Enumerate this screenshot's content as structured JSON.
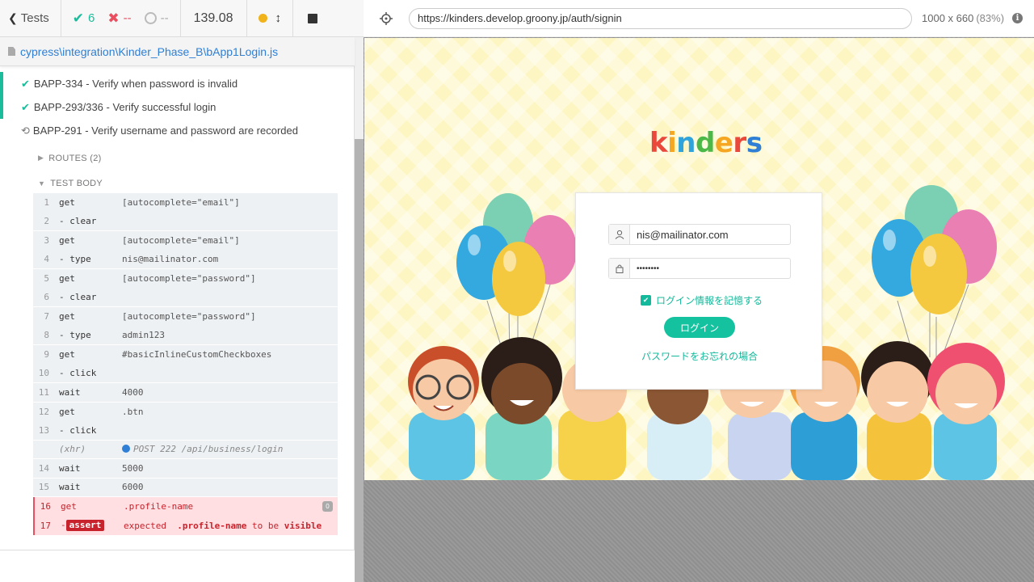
{
  "topbar": {
    "tests_label": "Tests",
    "passed": "6",
    "failed": "--",
    "pending": "--",
    "duration": "139.08"
  },
  "spec": {
    "path": "cypress\\integration\\Kinder_Phase_B\\bApp1Login.js"
  },
  "tests": [
    {
      "title": "BAPP-334 - Verify when password is invalid",
      "state": "passed"
    },
    {
      "title": "BAPP-293/336 - Verify successful login",
      "state": "passed"
    },
    {
      "title": "BAPP-291 - Verify username and password are recorded",
      "state": "running"
    }
  ],
  "sections": {
    "routes": "ROUTES (2)",
    "test_body": "TEST BODY"
  },
  "commands": [
    {
      "num": "1",
      "name": "get",
      "msg": "[autocomplete=\"email\"]"
    },
    {
      "num": "2",
      "name": "- clear",
      "msg": ""
    },
    {
      "num": "3",
      "name": "get",
      "msg": "[autocomplete=\"email\"]"
    },
    {
      "num": "4",
      "name": "- type",
      "msg": "nis@mailinator.com"
    },
    {
      "num": "5",
      "name": "get",
      "msg": "[autocomplete=\"password\"]"
    },
    {
      "num": "6",
      "name": "- clear",
      "msg": ""
    },
    {
      "num": "7",
      "name": "get",
      "msg": "[autocomplete=\"password\"]"
    },
    {
      "num": "8",
      "name": "- type",
      "msg": "admin123"
    },
    {
      "num": "9",
      "name": "get",
      "msg": "#basicInlineCustomCheckboxes"
    },
    {
      "num": "10",
      "name": "- click",
      "msg": ""
    },
    {
      "num": "11",
      "name": "wait",
      "msg": "4000"
    },
    {
      "num": "12",
      "name": "get",
      "msg": ".btn"
    },
    {
      "num": "13",
      "name": "- click",
      "msg": ""
    },
    {
      "num": "",
      "name": "(xhr)",
      "msg": "POST 222 /api/business/login"
    },
    {
      "num": "14",
      "name": "wait",
      "msg": "5000"
    },
    {
      "num": "15",
      "name": "wait",
      "msg": "6000"
    },
    {
      "num": "16",
      "name": "get",
      "msg": ".profile-name",
      "badge": "0"
    },
    {
      "num": "17",
      "name": "-",
      "assert": "assert",
      "msg_parts": [
        "expected",
        ".profile-name",
        "to be",
        "visible"
      ]
    }
  ],
  "aut": {
    "url": "https://kinders.develop.groony.jp/auth/signin",
    "viewport": "1000 x 660",
    "scale": "(83%)",
    "info": "i"
  },
  "app": {
    "logo": [
      "k",
      "i",
      "n",
      "d",
      "e",
      "r",
      "s"
    ],
    "logo_colors": [
      "#e9483a",
      "#f5a623",
      "#2ea3dc",
      "#4cb848",
      "#f5a623",
      "#e9483a",
      "#2e7fd5"
    ],
    "email": "nis@mailinator.com",
    "password_mask": "••••••••",
    "remember_label": "ログイン情報を記憶する",
    "login_button": "ログイン",
    "forgot_link": "パスワードをお忘れの場合"
  }
}
